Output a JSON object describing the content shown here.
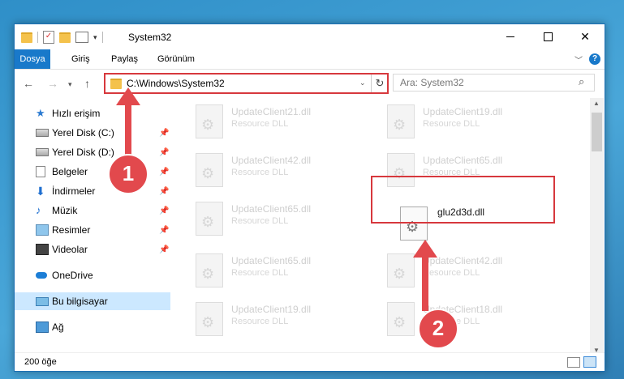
{
  "window": {
    "title": "System32"
  },
  "ribbon": {
    "tabs": [
      "Dosya",
      "Giriş",
      "Paylaş",
      "Görünüm"
    ]
  },
  "address": {
    "path": "C:\\Windows\\System32"
  },
  "search": {
    "placeholder": "Ara: System32"
  },
  "sidebar": {
    "items": [
      {
        "label": "Hızlı erişim",
        "icon": "star-icon"
      },
      {
        "label": "Yerel Disk (C:)",
        "icon": "drive-icon",
        "pinned": true
      },
      {
        "label": "Yerel Disk (D:)",
        "icon": "drive-icon",
        "pinned": true
      },
      {
        "label": "Belgeler",
        "icon": "documents-icon",
        "pinned": true
      },
      {
        "label": "İndirmeler",
        "icon": "download-icon",
        "pinned": true
      },
      {
        "label": "Müzik",
        "icon": "music-icon",
        "pinned": true
      },
      {
        "label": "Resimler",
        "icon": "pictures-icon",
        "pinned": true
      },
      {
        "label": "Videolar",
        "icon": "videos-icon",
        "pinned": true
      },
      {
        "label": "OneDrive",
        "icon": "onedrive-icon"
      },
      {
        "label": "Bu bilgisayar",
        "icon": "this-pc-icon",
        "selected": true
      },
      {
        "label": "Ağ",
        "icon": "network-icon"
      }
    ]
  },
  "files": [
    {
      "name": "UpdateClient21.dll",
      "type": "Resource DLL"
    },
    {
      "name": "UpdateClient19.dll",
      "type": "Resource DLL"
    },
    {
      "name": "UpdateClient42.dll",
      "type": "Resource DLL"
    },
    {
      "name": "UpdateClient65.dll",
      "type": "Resource DLL"
    },
    {
      "name": "UpdateClient65.dll",
      "type": "Resource DLL"
    },
    {
      "name": "glu2d3d.dll",
      "type": "",
      "highlighted": true
    },
    {
      "name": "UpdateClient65.dll",
      "type": "Resource DLL"
    },
    {
      "name": "UpdateClient42.dll",
      "type": "Resource DLL"
    },
    {
      "name": "UpdateClient19.dll",
      "type": "Resource DLL"
    },
    {
      "name": "UpdateClient18.dll",
      "type": "Resource DLL"
    }
  ],
  "status": {
    "count": "200 öğe"
  },
  "callouts": {
    "one": "1",
    "two": "2"
  },
  "colors": {
    "accent": "#1979ca",
    "highlight": "#d7383d",
    "callout": "#e2494d"
  }
}
